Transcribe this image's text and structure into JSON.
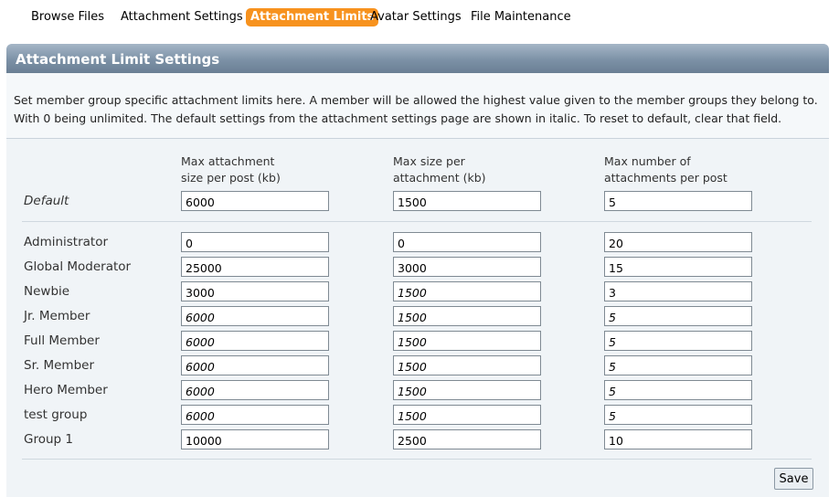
{
  "tabs": [
    {
      "label": "Browse Files",
      "active": false
    },
    {
      "label": "Attachment Settings",
      "active": false
    },
    {
      "label": "Attachment Limits",
      "active": true
    },
    {
      "label": "Avatar Settings",
      "active": false
    },
    {
      "label": "File Maintenance",
      "active": false
    }
  ],
  "section_title": "Attachment Limit Settings",
  "description": {
    "line1": "Set member group specific attachment limits here. A member will be allowed the highest value given to the member groups they belong to.",
    "line2": "With 0 being unlimited. The default settings from the attachment settings page are shown in italic. To reset to default, clear that field."
  },
  "columns": {
    "col1": "Max attachment\nsize per post (kb)",
    "col2": "Max size per\nattachment (kb)",
    "col3": "Max number of\nattachments per post"
  },
  "default_row": {
    "label": "Default",
    "size_per_post": "6000",
    "size_per_attachment": "1500",
    "num_attachments": "5"
  },
  "groups": [
    {
      "label": "Administrator",
      "size_per_post": "0",
      "size_per_attachment": "0",
      "num_attachments": "20"
    },
    {
      "label": "Global Moderator",
      "size_per_post": "25000",
      "size_per_attachment": "3000",
      "num_attachments": "15"
    },
    {
      "label": "Newbie",
      "size_per_post": "3000",
      "size_per_attachment": "1500",
      "num_attachments": "3"
    },
    {
      "label": "Jr. Member",
      "size_per_post": "6000",
      "size_per_attachment": "1500",
      "num_attachments": "5"
    },
    {
      "label": "Full Member",
      "size_per_post": "6000",
      "size_per_attachment": "1500",
      "num_attachments": "5"
    },
    {
      "label": "Sr. Member",
      "size_per_post": "6000",
      "size_per_attachment": "1500",
      "num_attachments": "5"
    },
    {
      "label": "Hero Member",
      "size_per_post": "6000",
      "size_per_attachment": "1500",
      "num_attachments": "5"
    },
    {
      "label": "test group",
      "size_per_post": "6000",
      "size_per_attachment": "1500",
      "num_attachments": "5"
    },
    {
      "label": "Group 1",
      "size_per_post": "10000",
      "size_per_attachment": "2500",
      "num_attachments": "10"
    }
  ],
  "italic_defaults": [
    [
      false,
      false,
      false
    ],
    [
      false,
      false,
      false
    ],
    [
      false,
      true,
      false
    ],
    [
      true,
      true,
      true
    ],
    [
      true,
      true,
      true
    ],
    [
      true,
      true,
      true
    ],
    [
      true,
      true,
      true
    ],
    [
      true,
      true,
      true
    ],
    [
      false,
      false,
      false
    ]
  ],
  "save_label": "Save",
  "colors": {
    "active_tab": "#f7921e",
    "header_bar": "#7c91a6",
    "panel": "#f0f4f7"
  }
}
